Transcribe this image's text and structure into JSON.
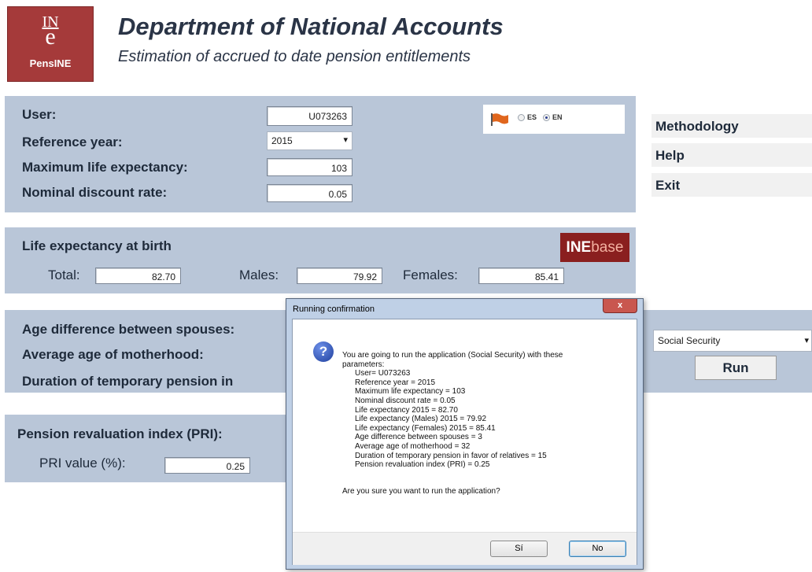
{
  "header": {
    "logo_top": "IN",
    "logo_mid": "e",
    "logo_name": "PensINE",
    "title": "Department of National Accounts",
    "subtitle": "Estimation of accrued to date pension entitlements"
  },
  "params": {
    "user_label": "User:",
    "user_value": "U073263",
    "ref_year_label": "Reference year:",
    "ref_year_value": "2015",
    "max_life_label": "Maximum life expectancy:",
    "max_life_value": "103",
    "discount_label": "Nominal discount rate:",
    "discount_value": "0.05"
  },
  "language": {
    "options": [
      "ES",
      "EN"
    ],
    "selected": "EN"
  },
  "menu": {
    "methodology": "Methodology",
    "help": "Help",
    "exit": "Exit"
  },
  "life": {
    "heading": "Life expectancy at birth",
    "total_label": "Total:",
    "total_value": "82.70",
    "males_label": "Males:",
    "males_value": "79.92",
    "females_label": "Females:",
    "females_value": "85.41",
    "inebase_a": "INE",
    "inebase_b": "base"
  },
  "spouses": {
    "age_diff_label": "Age difference between spouses:",
    "motherhood_label": "Average age of motherhood:",
    "duration_label": "Duration of temporary pension in"
  },
  "regime": {
    "selected": "Social Security",
    "run_label": "Run"
  },
  "pri": {
    "heading": "Pension revaluation index (PRI):",
    "value_label": "PRI value (%):",
    "value": "0.25"
  },
  "dialog": {
    "title": "Running confirmation",
    "close": "x",
    "lines": [
      "You are going to run the application (Social Security) with these",
      "parameters:",
      "User= U073263",
      "Reference year = 2015",
      "Maximum life expectancy = 103",
      "Nominal discount rate = 0.05",
      "Life expectancy 2015 = 82.70",
      "Life expectancy (Males) 2015 = 79.92",
      "Life expectancy (Females) 2015 = 85.41",
      "Age difference between spouses = 3",
      "Average age of motherhood = 32",
      "Duration of temporary pension in favor of relatives = 15",
      "Pension revaluation index (PRI) = 0.25"
    ],
    "question": "Are you sure you want to run the application?",
    "yes_label": "Sí",
    "no_label": "No"
  }
}
